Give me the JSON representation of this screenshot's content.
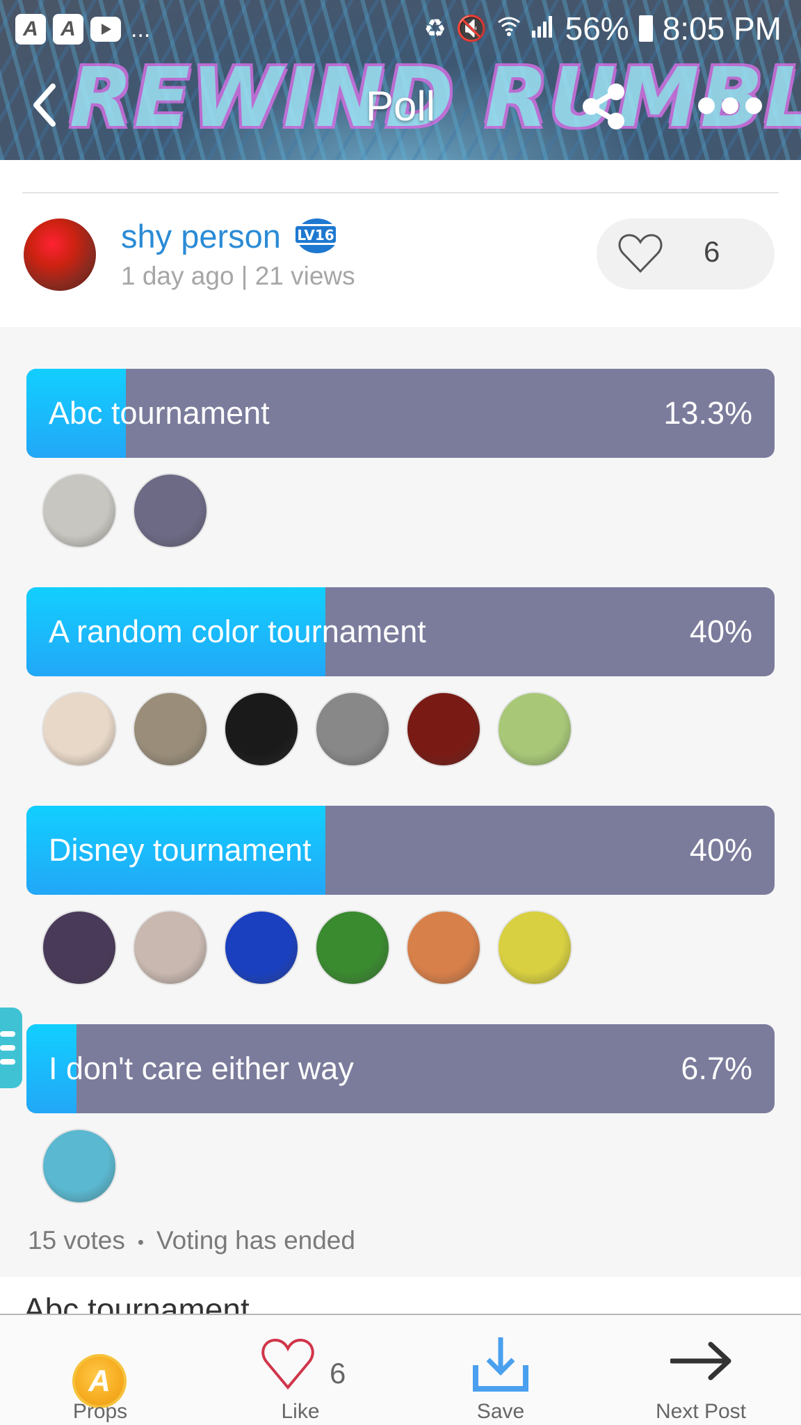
{
  "status_bar": {
    "left_icons": [
      "amino-app-icon",
      "amino-app-icon",
      "youtube-icon",
      "more-notifications"
    ],
    "more_notifications": "...",
    "right_icons": [
      "recycle-icon",
      "mute-icon",
      "wifi-icon",
      "signal-icon"
    ],
    "battery": "56%",
    "time": "8:05 PM"
  },
  "header": {
    "banner_text": "REWIND RUMBLE",
    "title": "Poll",
    "back_icon": "chevron-left-icon",
    "share_icon": "share-icon",
    "more_icon": "more-dots-icon"
  },
  "author": {
    "name": "shy person",
    "level_badge": "LV16",
    "meta": "1 day ago | 21 views",
    "like_count": "6"
  },
  "poll": {
    "options": [
      {
        "label": "Abc tournament",
        "percent_text": "13.3%",
        "percent": 13.3,
        "voter_count": 2
      },
      {
        "label": "A random color tournament",
        "percent_text": "40%",
        "percent": 40,
        "voter_count": 6
      },
      {
        "label": "Disney tournament",
        "percent_text": "40%",
        "percent": 40,
        "voter_count": 6
      },
      {
        "label": "I don't care either way",
        "percent_text": "6.7%",
        "percent": 6.7,
        "voter_count": 1
      }
    ],
    "total_votes": "15 votes",
    "separator": "•",
    "status": "Voting has ended",
    "colors": {
      "fill": "#1cbcfb",
      "track": "#7b7b9c"
    }
  },
  "post_body": {
    "title": "Abc tournament"
  },
  "bottom_bar": {
    "props_label": "Props",
    "like_label": "Like",
    "like_count": "6",
    "save_label": "Save",
    "next_label": "Next Post",
    "coin_glyph": "A"
  },
  "voter_avatars": [
    [
      "#c8c6c0",
      "#6d6a86"
    ],
    [
      "#e8d8c8",
      "#9a8e7a",
      "#1a1a1a",
      "#888888",
      "#7a1a14",
      "#a8c878"
    ],
    [
      "#4a3a5a",
      "#c8b8b0",
      "#1a40c0",
      "#3a8a30",
      "#d8804a",
      "#d8d040"
    ],
    [
      "#5ab8d0"
    ]
  ]
}
